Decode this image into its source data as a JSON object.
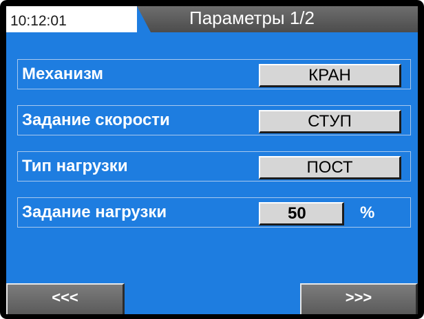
{
  "header": {
    "time": "10:12:01",
    "title": "Параметры 1/2"
  },
  "params": [
    {
      "label": "Механизм",
      "value": "КРАН",
      "unit": ""
    },
    {
      "label": "Задание скорости",
      "value": "СТУП",
      "unit": ""
    },
    {
      "label": "Тип нагрузки",
      "value": "ПОСТ",
      "unit": ""
    },
    {
      "label": "Задание нагрузки",
      "value": "50",
      "unit": "%"
    }
  ],
  "nav": {
    "prev_label": "<<<",
    "next_label": ">>>"
  },
  "colors": {
    "screen_bg": "#1e7de0",
    "header_bar": "#5c5c5c",
    "value_bg": "#d6d6d6",
    "text": "#ffffff"
  }
}
